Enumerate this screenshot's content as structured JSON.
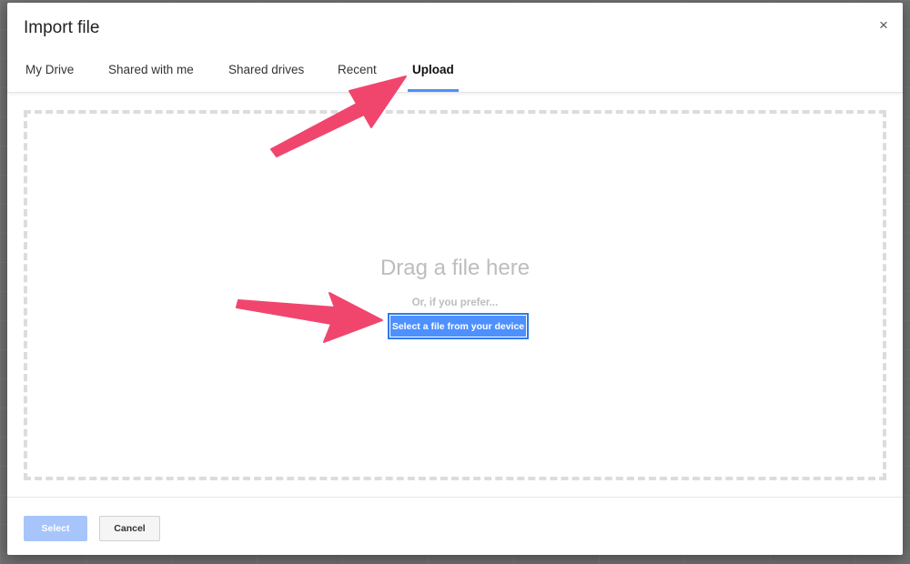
{
  "dialog": {
    "title": "Import file",
    "close_glyph": "×",
    "close_icon": "close-icon"
  },
  "tabs": [
    {
      "label": "My Drive",
      "active": false
    },
    {
      "label": "Shared with me",
      "active": false
    },
    {
      "label": "Shared drives",
      "active": false
    },
    {
      "label": "Recent",
      "active": false
    },
    {
      "label": "Upload",
      "active": true
    }
  ],
  "upload": {
    "drag_text": "Drag a file here",
    "prefer_text": "Or, if you prefer...",
    "select_device_label": "Select a file from your device"
  },
  "footer": {
    "select_label": "Select",
    "cancel_label": "Cancel"
  },
  "annotations": {
    "arrow_color": "#f0466e",
    "arrow_icon": "arrow-annotation-icon"
  },
  "colors": {
    "accent": "#4d90fe",
    "select_disabled": "#a7c5fb"
  }
}
